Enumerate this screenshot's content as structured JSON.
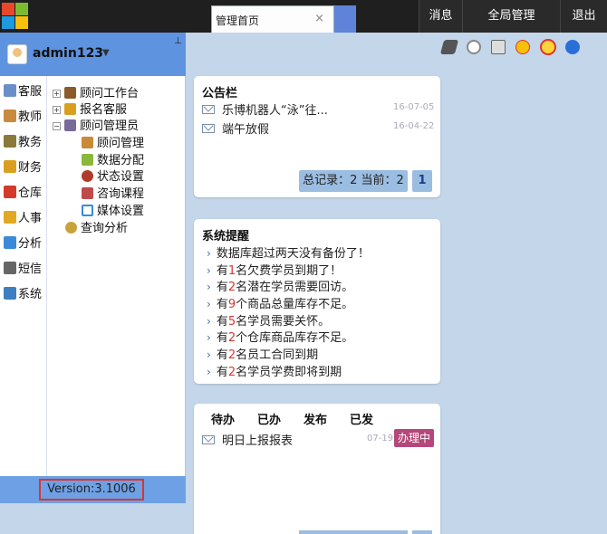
{
  "tabs": [
    {
      "label": "管理首页",
      "close": "×"
    }
  ],
  "topnav": {
    "messages": "消息",
    "global_manage": "全局管理",
    "exit": "退出"
  },
  "user": {
    "name": "admin123",
    "caret": "▼",
    "pin": "⊥"
  },
  "modules": [
    {
      "label": "客服",
      "icon": "service-icon",
      "color": "#6a8fc8"
    },
    {
      "label": "教师",
      "icon": "teacher-icon",
      "color": "#c88a3c"
    },
    {
      "label": "教务",
      "icon": "academic-icon",
      "color": "#8a7a3a"
    },
    {
      "label": "财务",
      "icon": "finance-icon",
      "color": "#d9a020"
    },
    {
      "label": "仓库",
      "icon": "warehouse-icon",
      "color": "#d33a2a"
    },
    {
      "label": "人事",
      "icon": "hr-icon",
      "color": "#e1a822"
    },
    {
      "label": "分析",
      "icon": "chart-icon",
      "color": "#3a8ad8"
    },
    {
      "label": "短信",
      "icon": "phone-icon",
      "color": "#666666"
    },
    {
      "label": "系统",
      "icon": "system-icon",
      "color": "#3d7fc0"
    }
  ],
  "tree": [
    {
      "label": "顾问工作台",
      "toggle": "+",
      "icon": "workbench-icon",
      "color": "#8a5a2a"
    },
    {
      "label": "报名客服",
      "toggle": "+",
      "icon": "signup-service-icon",
      "color": "#d9a020"
    },
    {
      "label": "顾问管理员",
      "toggle": "−",
      "icon": "admin-icon",
      "color": "#7a6a9a"
    },
    {
      "label": "顾问管理",
      "icon": "consultant-manage-icon",
      "color": "#c98a3a"
    },
    {
      "label": "数据分配",
      "icon": "data-assign-icon",
      "color": "#8ab83a"
    },
    {
      "label": "状态设置",
      "icon": "status-icon",
      "color": "#b23a2a"
    },
    {
      "label": "咨询课程",
      "icon": "course-icon",
      "color": "#c04a4a"
    },
    {
      "label": "媒体设置",
      "icon": "media-icon",
      "color": "#3a8ad8"
    },
    {
      "label": "查询分析",
      "icon": "search-analysis-icon",
      "color": "#c9a23a"
    }
  ],
  "version": "Version:3.1006",
  "toolbar": [
    "print-icon",
    "globe-icon",
    "fax-icon",
    "mcdonalds-icon",
    "smiley-icon",
    "help-icon"
  ],
  "notice": {
    "title": "公告栏",
    "items": [
      {
        "text": "乐博机器人“泳”往...",
        "date": "16-07-05"
      },
      {
        "text": "端午放假",
        "date": "16-04-22"
      }
    ],
    "pager": {
      "summary": "总记录：2 当前：2",
      "page": "1"
    }
  },
  "reminder": {
    "title": "系统提醒",
    "items": [
      {
        "pre": "数据库超过两天没有备份了！",
        "num": "",
        "post": ""
      },
      {
        "pre": "有",
        "num": "1",
        "post": "名欠费学员到期了！"
      },
      {
        "pre": "有",
        "num": "2",
        "post": "名潜在学员需要回访。"
      },
      {
        "pre": "有",
        "num": "9",
        "post": "个商品总量库存不足。"
      },
      {
        "pre": "有",
        "num": "5",
        "post": "名学员需要关怀。"
      },
      {
        "pre": "有",
        "num": "2",
        "post": "个仓库商品库存不足。"
      },
      {
        "pre": "有",
        "num": "2",
        "post": "名员工合同到期"
      },
      {
        "pre": "有",
        "num": "2",
        "post": "名学员学费即将到期"
      }
    ]
  },
  "tasks": {
    "tabs": [
      "待办",
      "已办",
      "发布",
      "已发"
    ],
    "items": [
      {
        "text": "明日上报报表",
        "date": "07-19",
        "action": "办理中"
      }
    ]
  },
  "colors": {
    "topbar": "#1f1f1f",
    "panel_blue": "#5e93e0",
    "accent_red": "#d9362f",
    "badge": "#b5477a"
  }
}
